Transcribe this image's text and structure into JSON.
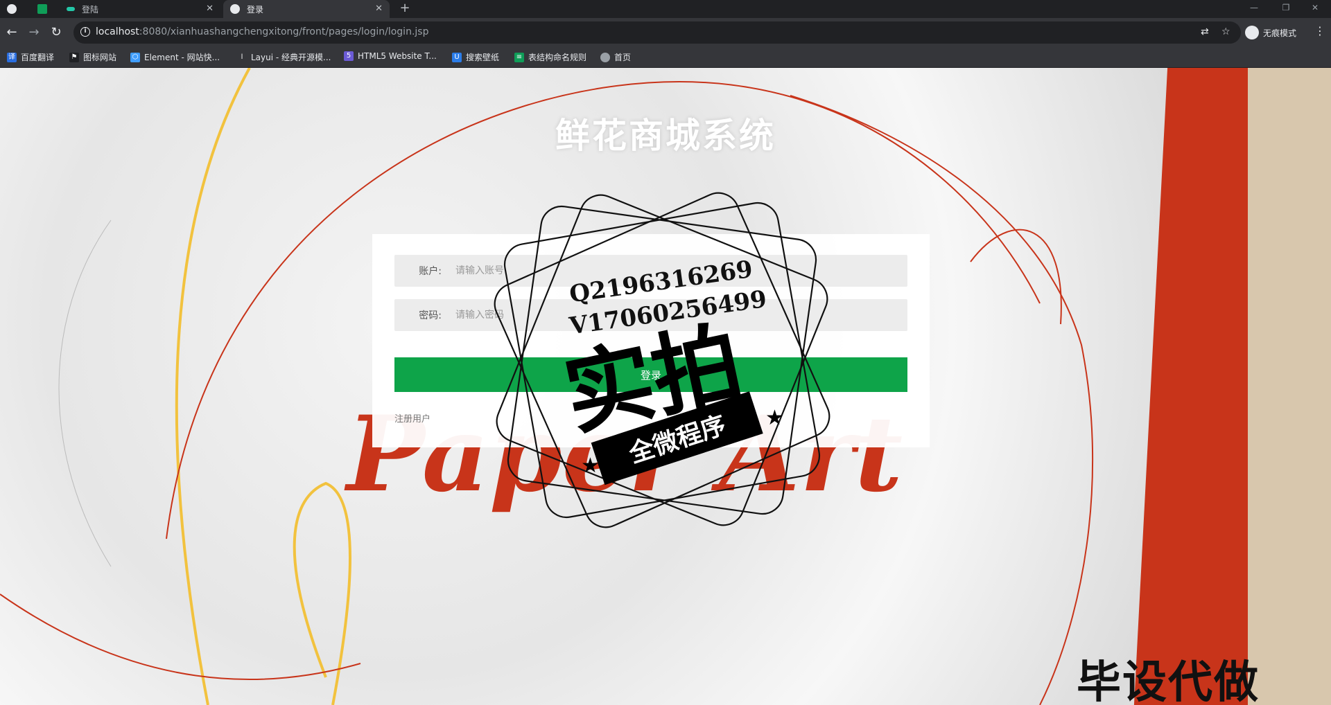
{
  "browser": {
    "tabs": [
      {
        "title": "",
        "icon": "globe-icon"
      },
      {
        "title": "",
        "icon": "table-app-icon"
      },
      {
        "title": "登陆",
        "icon": "dots-app-icon"
      },
      {
        "title": "登录",
        "icon": "globe-icon"
      }
    ],
    "new_tab_symbol": "+",
    "address": {
      "host": "localhost",
      "path": ":8080/xianhuashangchengxitong/front/pages/login/login.jsp"
    },
    "profile_label": "无痕模式",
    "bookmarks": [
      {
        "label": "百度翻译",
        "icon": "translate-icon",
        "color": "#2a6ee0"
      },
      {
        "label": "图标网站",
        "icon": "flag-icon",
        "color": "#202124"
      },
      {
        "label": "Element - 网站快...",
        "icon": "hexagon-icon",
        "color": "#409eff"
      },
      {
        "label": "Layui - 经典开源模...",
        "icon": "layui-icon",
        "color": "#35363a"
      },
      {
        "label": "HTML5 Website T...",
        "icon": "html5-icon",
        "color": "#6b5bd6"
      },
      {
        "label": "搜索壁纸",
        "icon": "u-icon",
        "color": "#2b7de9"
      },
      {
        "label": "表结构命名规则",
        "icon": "table-app-icon",
        "color": "#0f9d58"
      },
      {
        "label": "首页",
        "icon": "globe-icon",
        "color": "#9aa0a6"
      }
    ]
  },
  "page": {
    "site_title": "鲜花商城系统",
    "form": {
      "account_label": "账户:",
      "account_placeholder": "请输入账号",
      "password_label": "密码:",
      "password_placeholder": "请输入密码",
      "login_button": "登录",
      "register_link": "注册用户"
    },
    "background_word": "Paper Art"
  },
  "watermark": {
    "line1": "Q2196316269",
    "line2": "V17060256499",
    "big_text": "实拍",
    "ribbon_text": "全微程序",
    "corner_text": "毕设代做"
  },
  "colors": {
    "login_button": "#0ea449",
    "brand_red": "#c8341a"
  }
}
